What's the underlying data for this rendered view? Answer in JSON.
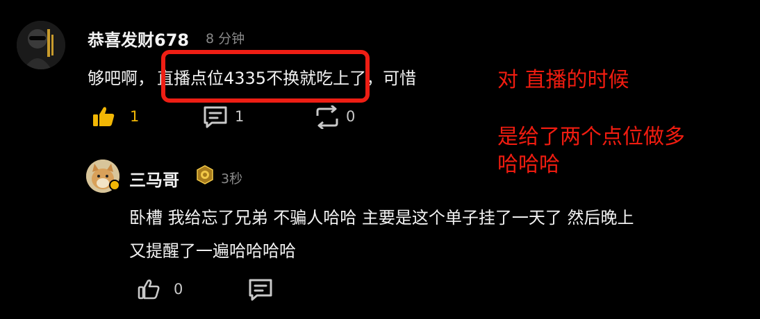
{
  "comment": {
    "username": "恭喜发财678",
    "time": "8 分钟",
    "text_before": "够吧啊，",
    "text_highlight": "直播点位4335不换就吃",
    "text_after": "上了，可惜",
    "likes": "1",
    "replies": "1",
    "reposts": "0"
  },
  "reply": {
    "username": "三马哥",
    "time": "3秒",
    "text_line1": "卧槽 我给忘了兄弟 不骗人哈哈 主要是这个单子挂了一天了 然后晚上",
    "text_line2": "又提醒了一遍哈哈哈哈",
    "likes": "0"
  },
  "annotation": {
    "line1": "对 直播的时候",
    "line2": "是给了两个点位做多",
    "line3": "哈哈哈"
  },
  "colors": {
    "background": "#000000",
    "liked": "#f2b705",
    "annotation": "#f01c10",
    "muted": "#8a8a8a"
  },
  "icons": [
    "thumb-up-icon",
    "comment-icon",
    "repost-icon",
    "verified-badge-icon",
    "achievement-badge-icon"
  ]
}
